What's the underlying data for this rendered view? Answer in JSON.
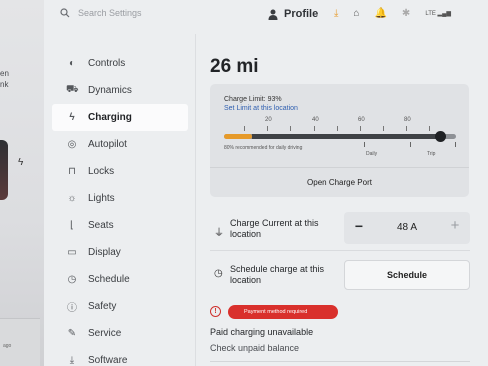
{
  "left_panel": {
    "text_top": "en",
    "text_mid": "nk",
    "text_ago": "ago"
  },
  "search": {
    "placeholder": "Search Settings",
    "icon": "search-icon"
  },
  "profile": {
    "label": "Profile",
    "icon": "person-icon"
  },
  "top_icons": [
    "download-icon",
    "garage-icon",
    "bell-icon",
    "bluetooth-icon",
    "lte-signal-icon"
  ],
  "lte_label": "LTE",
  "sidebar": {
    "items": [
      {
        "label": "Controls",
        "icon": "toggle-icon",
        "glyph": "◐",
        "active": false
      },
      {
        "label": "Dynamics",
        "icon": "car-icon",
        "glyph": "⛟",
        "active": false
      },
      {
        "label": "Charging",
        "icon": "bolt-icon",
        "glyph": "ϟ",
        "active": true
      },
      {
        "label": "Autopilot",
        "icon": "steering-wheel-icon",
        "glyph": "◎",
        "active": false
      },
      {
        "label": "Locks",
        "icon": "lock-icon",
        "glyph": "🔒",
        "active": false
      },
      {
        "label": "Lights",
        "icon": "sun-icon",
        "glyph": "☼",
        "active": false
      },
      {
        "label": "Seats",
        "icon": "seat-icon",
        "glyph": "⌊",
        "active": false
      },
      {
        "label": "Display",
        "icon": "display-icon",
        "glyph": "▭",
        "active": false
      },
      {
        "label": "Schedule",
        "icon": "alarm-clock-icon",
        "glyph": "⏰",
        "active": false
      },
      {
        "label": "Safety",
        "icon": "alert-circle-icon",
        "glyph": "ⓘ",
        "active": false
      },
      {
        "label": "Service",
        "icon": "wrench-icon",
        "glyph": "✎",
        "active": false
      },
      {
        "label": "Software",
        "icon": "download-arrow-icon",
        "glyph": "⤓",
        "active": false
      }
    ]
  },
  "range": "26 mi",
  "charge_limit": {
    "title": "Charge Limit: 93%",
    "link": "Set Limit at this location",
    "tick_labels": [
      "20",
      "40",
      "60",
      "80"
    ],
    "current_level_percent": 12,
    "limit_percent": 93,
    "recommendation": "80% recommended for daily driving",
    "daily_label": "Daily",
    "trip_label": "Trip"
  },
  "open_charge_port": "Open Charge Port",
  "charge_current": {
    "label": "Charge Current at this location",
    "value": "48 A",
    "minus": "−",
    "plus": "+"
  },
  "schedule": {
    "label": "Schedule charge at this location",
    "button": "Schedule"
  },
  "payment": {
    "badge": "Payment method required",
    "alert_glyph": "!",
    "paid_status": "Paid charging unavailable",
    "check_balance": "Check unpaid balance"
  },
  "colors": {
    "accent_orange": "#e69a2a",
    "alert_red": "#d9302c",
    "link_blue": "#2f5fb0"
  }
}
